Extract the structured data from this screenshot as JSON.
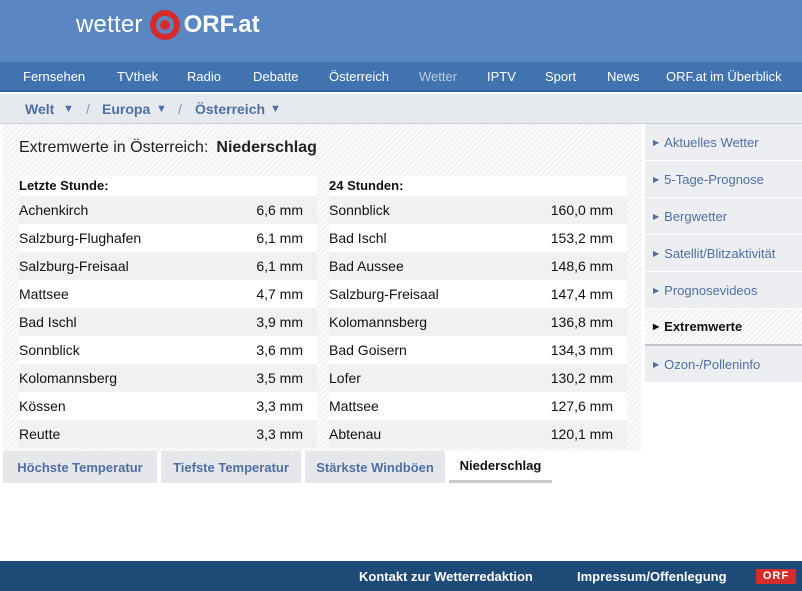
{
  "logo": {
    "wetter": "wetter",
    "orf": "ORF.at"
  },
  "nav": [
    "Fernsehen",
    "TVthek",
    "Radio",
    "Debatte",
    "Österreich",
    "Wetter",
    "IPTV",
    "Sport",
    "News",
    "ORF.at im Überblick"
  ],
  "nav_active": "Wetter",
  "breadcrumbs": {
    "world": "Welt",
    "europe": "Europa",
    "austria": "Österreich",
    "separator": "/",
    "dropdown_icon": "▼"
  },
  "title": {
    "prefix": "Extremwerte in Österreich:",
    "category": "Niederschlag"
  },
  "last_hour": {
    "header": "Letzte Stunde:",
    "rows": [
      {
        "place": "Achenkirch",
        "value": "6,6 mm"
      },
      {
        "place": "Salzburg-Flughafen",
        "value": "6,1 mm"
      },
      {
        "place": "Salzburg-Freisaal",
        "value": "6,1 mm"
      },
      {
        "place": "Mattsee",
        "value": "4,7 mm"
      },
      {
        "place": "Bad Ischl",
        "value": "3,9 mm"
      },
      {
        "place": "Sonnblick",
        "value": "3,6 mm"
      },
      {
        "place": "Kolomannsberg",
        "value": "3,5 mm"
      },
      {
        "place": "Kössen",
        "value": "3,3 mm"
      },
      {
        "place": "Reutte",
        "value": "3,3 mm"
      }
    ]
  },
  "day": {
    "header": "24 Stunden:",
    "rows": [
      {
        "place": "Sonnblick",
        "value": "160,0 mm"
      },
      {
        "place": "Bad Ischl",
        "value": "153,2 mm"
      },
      {
        "place": "Bad Aussee",
        "value": "148,6 mm"
      },
      {
        "place": "Salzburg-Freisaal",
        "value": "147,4 mm"
      },
      {
        "place": "Kolomannsberg",
        "value": "136,8 mm"
      },
      {
        "place": "Bad Goisern",
        "value": "134,3 mm"
      },
      {
        "place": "Lofer",
        "value": "130,2 mm"
      },
      {
        "place": "Mattsee",
        "value": "127,6 mm"
      },
      {
        "place": "Abtenau",
        "value": "120,1 mm"
      }
    ]
  },
  "tabs": [
    "Höchste Temperatur",
    "Tiefste Temperatur",
    "Stärkste Windböen",
    "Niederschlag"
  ],
  "tab_selected": "Niederschlag",
  "sidebar": {
    "arrow_icon": "▶",
    "items": [
      "Aktuelles Wetter",
      "5-Tage-Prognose",
      "Bergwetter",
      "Satellit/Blitzaktivität",
      "Prognosevideos",
      "Extremwerte",
      "Ozon-/Polleninfo"
    ],
    "active": "Extremwerte"
  },
  "footer": {
    "contact": "Kontakt zur Wetterredaktion",
    "imprint": "Impressum/Offenlegung",
    "brand": "ORF"
  },
  "colors": {
    "header_bg": "#5a87c2",
    "nav_bg": "#4173b0",
    "footer_bg": "#1e4a78",
    "link": "#4f6fa3",
    "logo_red": "#d52b2b"
  }
}
